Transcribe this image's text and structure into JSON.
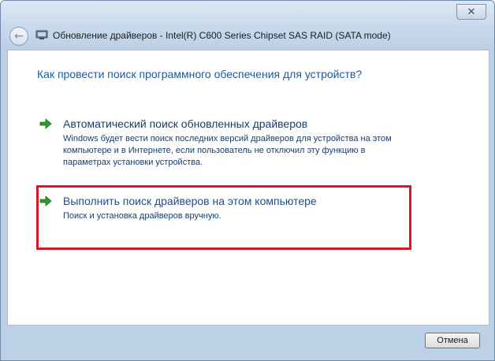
{
  "window": {
    "title": "Обновление драйверов - Intel(R) C600 Series Chipset SAS RAID (SATA mode)",
    "close_label": "✕",
    "back_label": "←"
  },
  "content": {
    "heading": "Как провести поиск программного обеспечения для устройств?",
    "options": [
      {
        "title": "Автоматический поиск обновленных драйверов",
        "description": "Windows будет вести поиск последних версий драйверов для устройства на этом компьютере и в Интернете, если пользователь не отключил эту функцию в параметрах установки устройства."
      },
      {
        "title": "Выполнить поиск драйверов на этом компьютере",
        "description": "Поиск и установка драйверов вручную."
      }
    ]
  },
  "footer": {
    "cancel_label": "Отмена"
  },
  "colors": {
    "accent_green": "#2f9a2f",
    "highlight_red": "#d41a20",
    "heading_blue": "#1d5a9e"
  },
  "icons": {
    "option_arrow": "green-arrow-icon",
    "title_device": "device-icon"
  }
}
